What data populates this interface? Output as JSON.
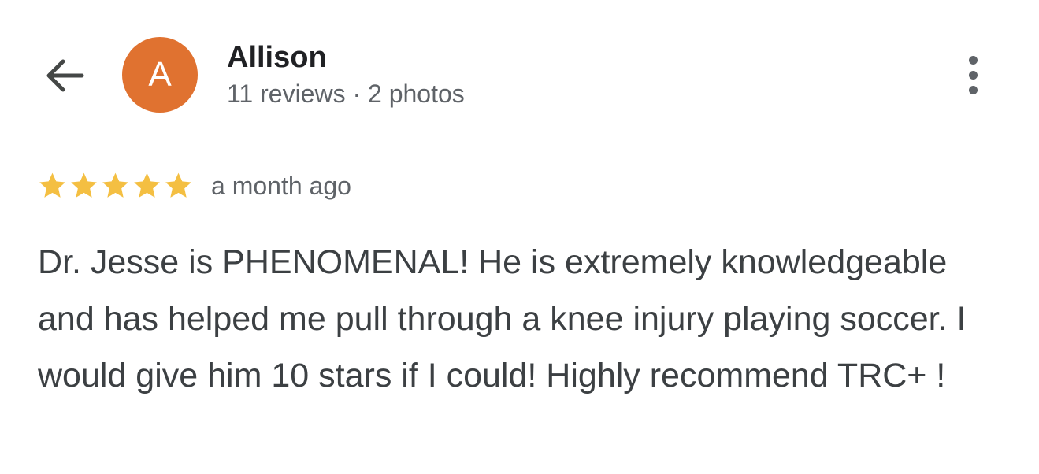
{
  "colors": {
    "avatar_bg": "#e07230",
    "star": "#f4bf42",
    "text_primary": "#202124",
    "text_secondary": "#5f6368"
  },
  "header": {
    "back_icon": "arrow-left-icon",
    "more_icon": "more-vert-icon"
  },
  "reviewer": {
    "initial": "A",
    "name": "Allison",
    "meta": "11 reviews · 2 photos"
  },
  "review": {
    "rating": 5,
    "max_rating": 5,
    "date": "a month ago",
    "text": "Dr. Jesse is PHENOMENAL! He is extremely knowledgeable and has helped me pull through a knee injury playing soccer. I would give him 10 stars if I could! Highly recommend TRC+ !"
  }
}
